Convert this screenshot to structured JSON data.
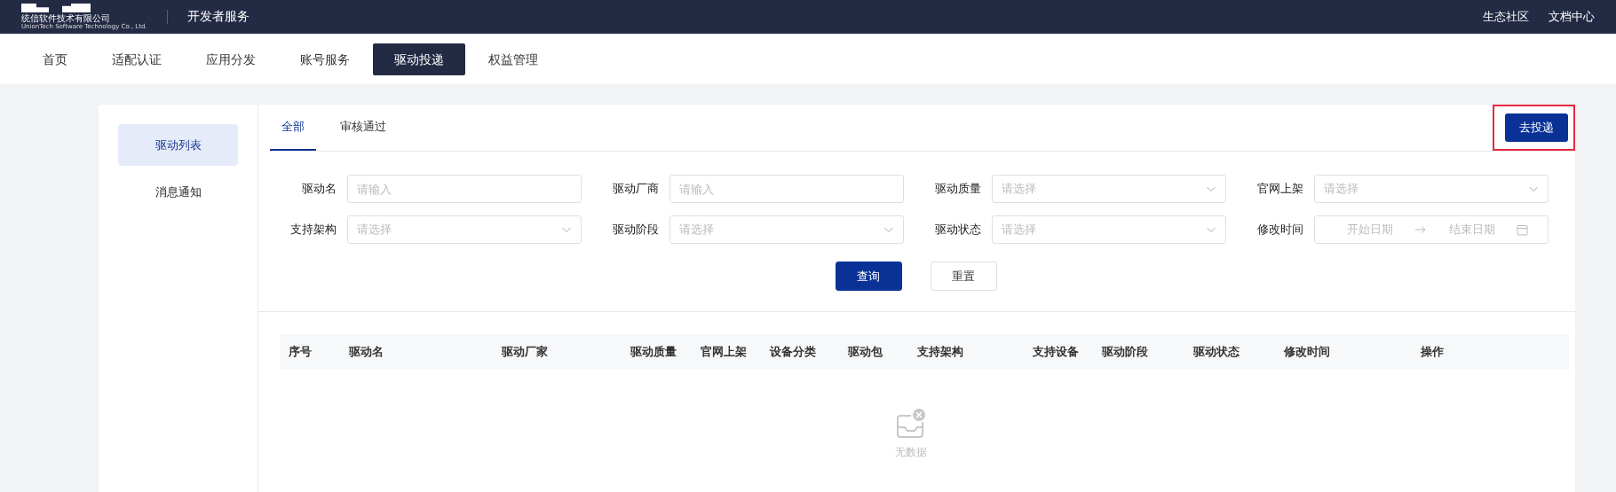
{
  "header": {
    "logo_text": "统信软件技术有限公司",
    "logo_subtext": "UnionTech Software Technology Co., Ltd.",
    "title": "开发者服务",
    "links": [
      "生态社区",
      "文档中心"
    ]
  },
  "nav": [
    {
      "label": "首页",
      "selected": false
    },
    {
      "label": "适配认证",
      "selected": false
    },
    {
      "label": "应用分发",
      "selected": false
    },
    {
      "label": "账号服务",
      "selected": false
    },
    {
      "label": "驱动投递",
      "selected": true
    },
    {
      "label": "权益管理",
      "selected": false
    }
  ],
  "sidebar": {
    "items": [
      {
        "label": "驱动列表",
        "selected": true
      },
      {
        "label": "消息通知",
        "selected": false
      }
    ]
  },
  "tabs": [
    {
      "label": "全部",
      "selected": true
    },
    {
      "label": "审核通过",
      "selected": false
    }
  ],
  "action_button": {
    "label": "去投递",
    "highlighted": true
  },
  "filters": [
    {
      "kind": "input",
      "label": "驱动名",
      "placeholder": "请输入"
    },
    {
      "kind": "input",
      "label": "驱动厂商",
      "placeholder": "请输入"
    },
    {
      "kind": "select",
      "label": "驱动质量",
      "placeholder": "请选择"
    },
    {
      "kind": "select",
      "label": "官网上架",
      "placeholder": "请选择"
    },
    {
      "kind": "select",
      "label": "支持架构",
      "placeholder": "请选择"
    },
    {
      "kind": "select",
      "label": "驱动阶段",
      "placeholder": "请选择"
    },
    {
      "kind": "select",
      "label": "驱动状态",
      "placeholder": "请选择"
    },
    {
      "kind": "daterange",
      "label": "修改时间",
      "start_placeholder": "开始日期",
      "end_placeholder": "结束日期"
    }
  ],
  "buttons": [
    {
      "kind": "primary",
      "label": "查询"
    },
    {
      "kind": "default",
      "label": "重置"
    }
  ],
  "table": {
    "columns": [
      "序号",
      "驱动名",
      "驱动厂家",
      "驱动质量",
      "官网上架",
      "设备分类",
      "驱动包",
      "支持架构",
      "支持设备",
      "驱动阶段",
      "驱动状态",
      "修改时间",
      "操作"
    ],
    "empty_text": "无数据"
  }
}
